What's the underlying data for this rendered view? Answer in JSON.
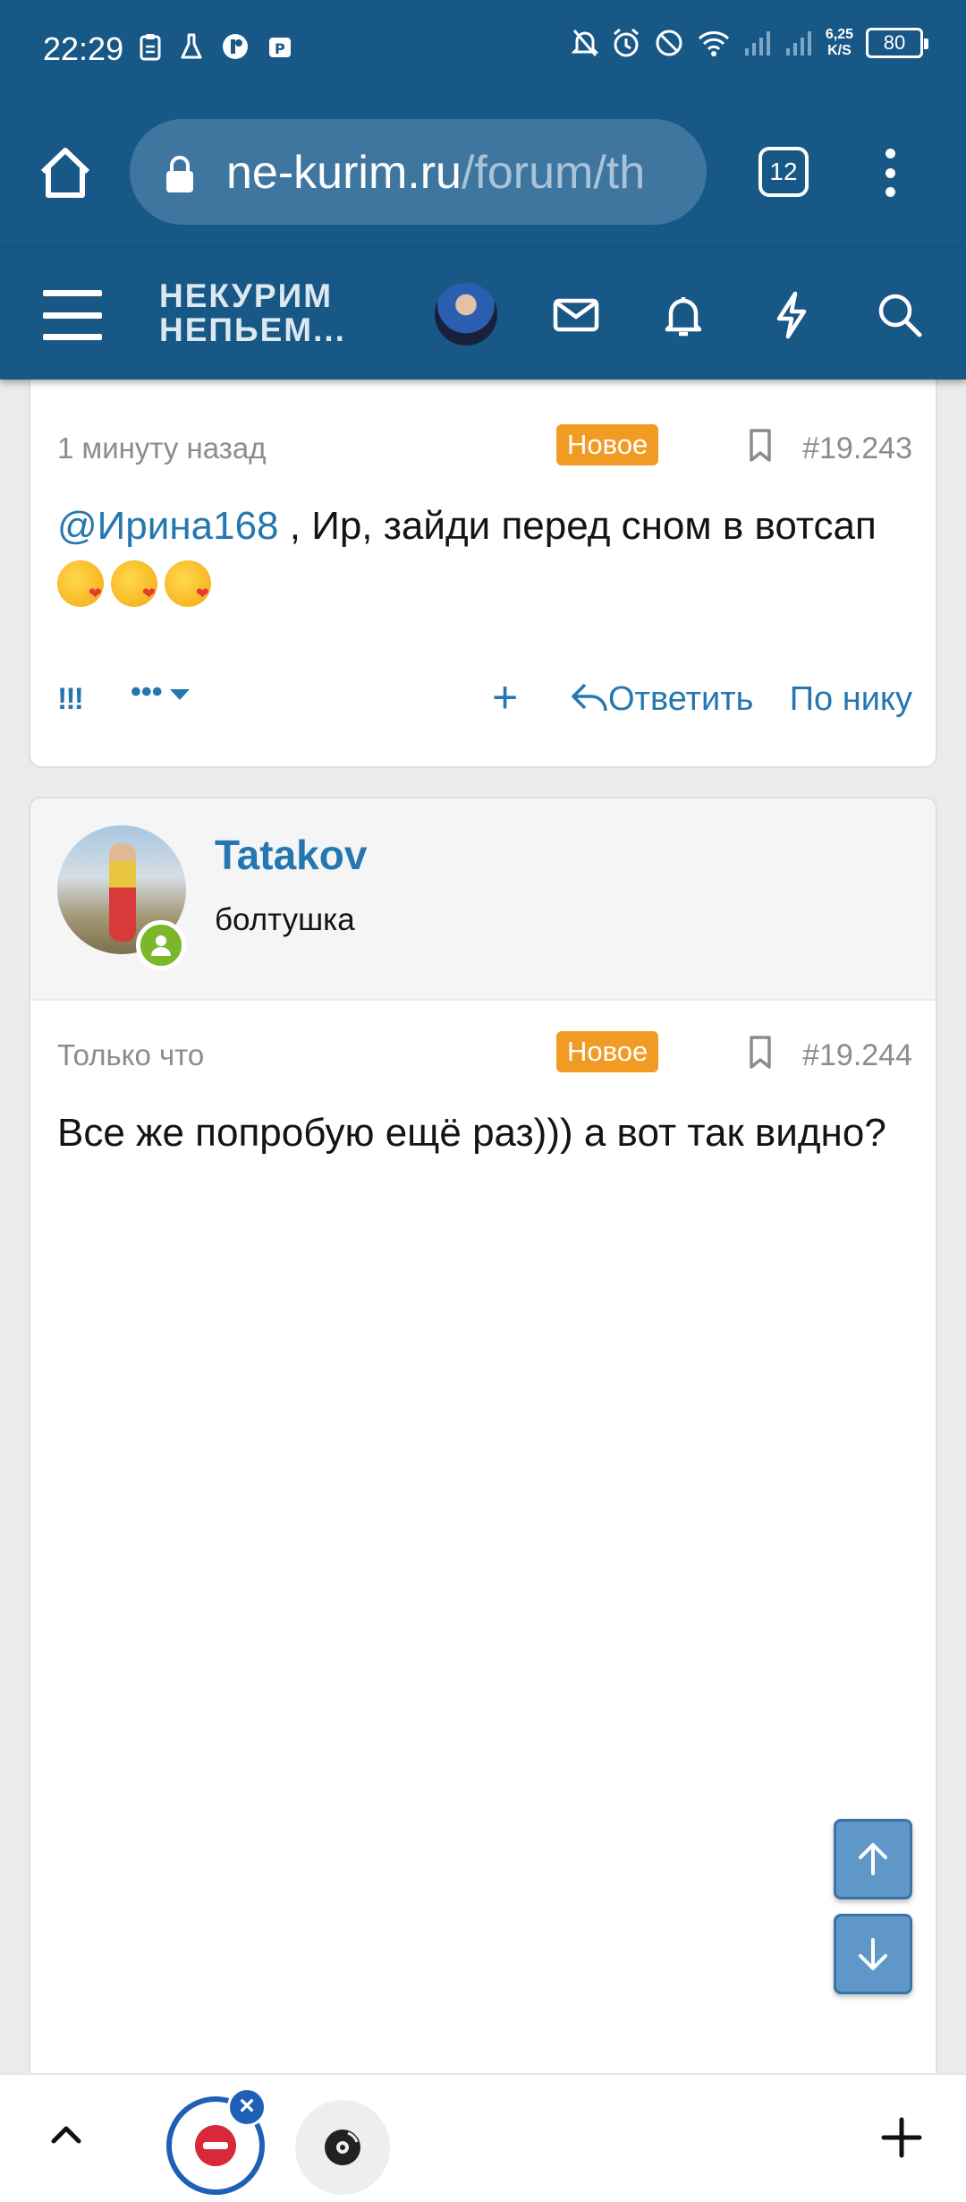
{
  "status_bar": {
    "time": "22:29",
    "net_speed_value": "6,25",
    "net_speed_unit": "K/S",
    "battery": "80"
  },
  "browser": {
    "url_domain": "ne-kurim.ru",
    "url_path": "/forum/th",
    "tab_count": "12"
  },
  "site_header": {
    "logo_line1": "НЕКУРИМ",
    "logo_line2": "НЕПЬЕМ..."
  },
  "posts": [
    {
      "time": "1 минуту назад",
      "badge": "Новое",
      "number": "#19.243",
      "mention": "@Ирина168",
      "text": " , Ир, зайди перед сном в вотсап ",
      "emojis": [
        "kissing-face-with-heart-icon",
        "kissing-face-with-heart-icon",
        "kissing-face-with-heart-icon"
      ],
      "actions": {
        "react": "!!!",
        "more": "•••",
        "add": "+",
        "reply": "Ответить",
        "by_nick": "По нику"
      }
    },
    {
      "author": "Tatakov",
      "author_title": "болтушка",
      "time": "Только что",
      "badge": "Новое",
      "number": "#19.244",
      "text": "Все же попробую ещё раз))) а вот так видно?"
    }
  ],
  "colors": {
    "header_bg": "#185886",
    "link": "#2577b1",
    "badge_new": "#f29b24",
    "online": "#7cb62b"
  }
}
